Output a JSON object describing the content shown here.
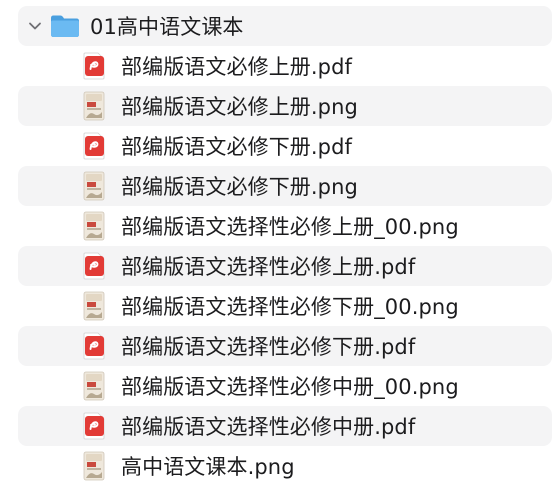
{
  "folder": {
    "name": "01高中语文课本",
    "expanded": true,
    "chevron_icon": "chevron-down-icon",
    "folder_icon": "folder-icon",
    "folder_color": "#5fb2ef"
  },
  "files": [
    {
      "name": "部编版语文必修上册.pdf",
      "type": "pdf",
      "icon": "pdf-icon"
    },
    {
      "name": "部编版语文必修上册.png",
      "type": "png",
      "icon": "image-thumbnail-icon"
    },
    {
      "name": "部编版语文必修下册.pdf",
      "type": "pdf",
      "icon": "pdf-icon"
    },
    {
      "name": "部编版语文必修下册.png",
      "type": "png",
      "icon": "image-thumbnail-icon"
    },
    {
      "name": "部编版语文选择性必修上册_00.png",
      "type": "png",
      "icon": "image-thumbnail-icon"
    },
    {
      "name": "部编版语文选择性必修上册.pdf",
      "type": "pdf",
      "icon": "pdf-icon"
    },
    {
      "name": "部编版语文选择性必修下册_00.png",
      "type": "png",
      "icon": "image-thumbnail-icon"
    },
    {
      "name": "部编版语文选择性必修下册.pdf",
      "type": "pdf",
      "icon": "pdf-icon"
    },
    {
      "name": "部编版语文选择性必修中册_00.png",
      "type": "png",
      "icon": "image-thumbnail-icon"
    },
    {
      "name": "部编版语文选择性必修中册.pdf",
      "type": "pdf",
      "icon": "pdf-icon"
    },
    {
      "name": "高中语文课本.png",
      "type": "png",
      "icon": "image-thumbnail-icon"
    }
  ],
  "colors": {
    "row_stripe": "#f4f4f5",
    "pdf_red": "#e23b36",
    "text": "#1c1c1e"
  }
}
